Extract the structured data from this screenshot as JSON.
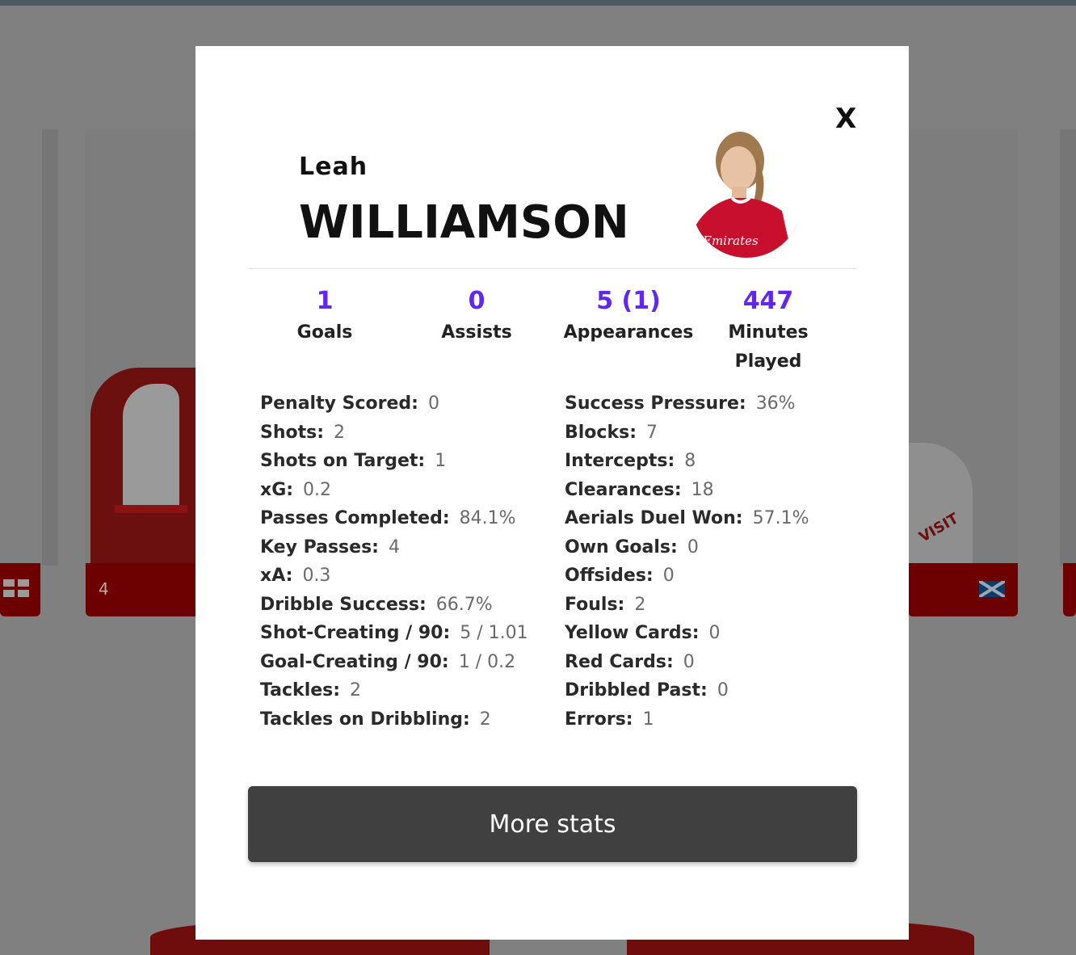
{
  "background": {
    "card_number": "4"
  },
  "modal": {
    "close_label": "X",
    "player": {
      "first_name": "Leah",
      "last_name": "WILLIAMSON"
    },
    "summary": [
      {
        "value": "1",
        "label": "Goals"
      },
      {
        "value": "0",
        "label": "Assists"
      },
      {
        "value": "5 (1)",
        "label": "Appearances"
      },
      {
        "value": "447",
        "label": "Minutes Played"
      }
    ],
    "stats_left": [
      {
        "label": "Penalty Scored:",
        "value": "0"
      },
      {
        "label": "Shots:",
        "value": "2"
      },
      {
        "label": "Shots on Target:",
        "value": "1"
      },
      {
        "label": "xG:",
        "value": "0.2"
      },
      {
        "label": "Passes Completed:",
        "value": "84.1%"
      },
      {
        "label": "Key Passes:",
        "value": "4"
      },
      {
        "label": "xA:",
        "value": "0.3"
      },
      {
        "label": "Dribble Success:",
        "value": "66.7%"
      },
      {
        "label": "Shot-Creating / 90:",
        "value": "5 / 1.01"
      },
      {
        "label": "Goal-Creating / 90:",
        "value": "1 / 0.2"
      },
      {
        "label": "Tackles:",
        "value": "2"
      },
      {
        "label": "Tackles on Dribbling:",
        "value": "2"
      }
    ],
    "stats_right": [
      {
        "label": "Success Pressure:",
        "value": "36%"
      },
      {
        "label": "Blocks:",
        "value": "7"
      },
      {
        "label": "Intercepts:",
        "value": "8"
      },
      {
        "label": "Clearances:",
        "value": "18"
      },
      {
        "label": "Aerials Duel Won:",
        "value": "57.1%"
      },
      {
        "label": "Own Goals:",
        "value": "0"
      },
      {
        "label": "Offsides:",
        "value": "0"
      },
      {
        "label": "Fouls:",
        "value": "2"
      },
      {
        "label": "Yellow Cards:",
        "value": "0"
      },
      {
        "label": "Red Cards:",
        "value": "0"
      },
      {
        "label": "Dribbled Past:",
        "value": "0"
      },
      {
        "label": "Errors:",
        "value": "1"
      }
    ],
    "more_button_label": "More stats"
  },
  "colors": {
    "accent": "#6226ef",
    "overlay": "#808080",
    "button": "#404040",
    "club_red": "#6d0000"
  }
}
